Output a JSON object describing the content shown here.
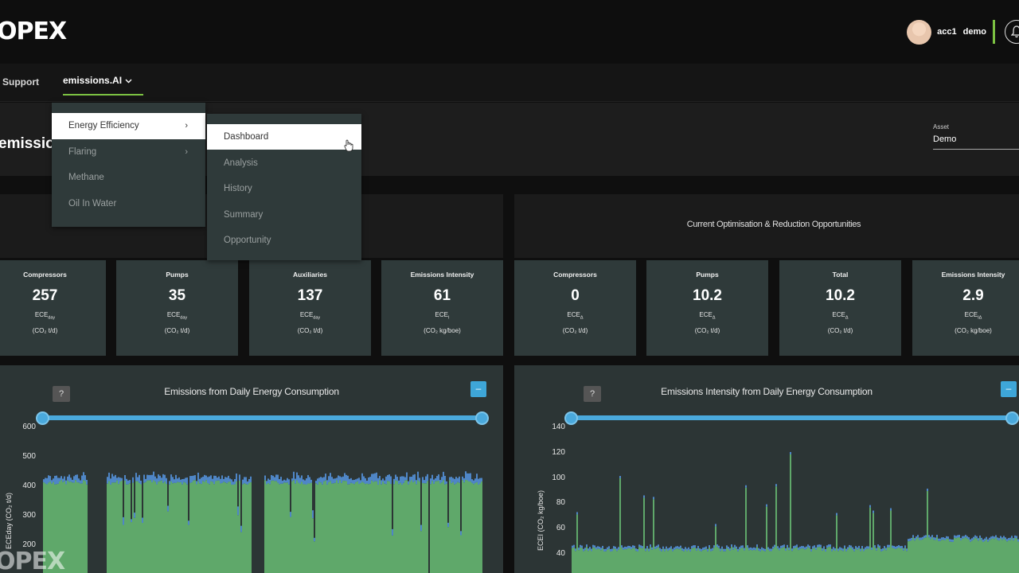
{
  "header": {
    "logo": "OPEX",
    "user": "acc1",
    "account": "demo",
    "icons": [
      "avatar",
      "bell-icon"
    ]
  },
  "nav": {
    "support": "Support",
    "emissions": "emissions.AI"
  },
  "page": {
    "title": "emissio",
    "asset_label": "Asset",
    "asset_value": "Demo"
  },
  "menu": {
    "items": [
      {
        "label": "Energy Efficiency",
        "has_sub": true,
        "active": true
      },
      {
        "label": "Flaring",
        "has_sub": true,
        "active": false
      },
      {
        "label": "Methane",
        "has_sub": false,
        "active": false
      },
      {
        "label": "Oil In Water",
        "has_sub": false,
        "active": false
      }
    ],
    "submenu": [
      {
        "label": "Dashboard",
        "active": true
      },
      {
        "label": "Analysis",
        "active": false
      },
      {
        "label": "History",
        "active": false
      },
      {
        "label": "Summary",
        "active": false
      },
      {
        "label": "Opportunity",
        "active": false
      }
    ]
  },
  "opportunities_title": "Current Optimisation & Reduction Opportunities",
  "cards": [
    {
      "label": "Compressors",
      "value": "257",
      "unit": "ECE",
      "unit_sub": "day",
      "sub": "(CO₂ t/d)"
    },
    {
      "label": "Pumps",
      "value": "35",
      "unit": "ECE",
      "unit_sub": "day",
      "sub": "(CO₂ t/d)"
    },
    {
      "label": "Auxiliaries",
      "value": "137",
      "unit": "ECE",
      "unit_sub": "day",
      "sub": "(CO₂ t/d)"
    },
    {
      "label": "Emissions Intensity",
      "value": "61",
      "unit": "ECE",
      "unit_sub": "I",
      "sub": "(CO₂ kg/boe)"
    },
    {
      "label": "Compressors",
      "value": "0",
      "unit": "ECE",
      "unit_sub": "Δ",
      "sub": "(CO₂ t/d)"
    },
    {
      "label": "Pumps",
      "value": "10.2",
      "unit": "ECE",
      "unit_sub": "Δ",
      "sub": "(CO₂ t/d)"
    },
    {
      "label": "Total",
      "value": "10.2",
      "unit": "ECE",
      "unit_sub": "Δ",
      "sub": "(CO₂ t/d)"
    },
    {
      "label": "Emissions Intensity",
      "value": "2.9",
      "unit": "ECE",
      "unit_sub": "IΔ",
      "sub": "(CO₂ kg/boe)"
    }
  ],
  "charts": {
    "left": {
      "title": "Emissions from Daily Energy Consumption",
      "ylabel": "ECEday (CO₂ t/d)",
      "yticks": [
        "600",
        "500",
        "400",
        "300",
        "200"
      ]
    },
    "right": {
      "title": "Emissions Intensity from Daily Energy Consumption",
      "ylabel": "ECEI (CO₂ kg/boe)",
      "yticks": [
        "140",
        "120",
        "100",
        "80",
        "60",
        "40"
      ]
    }
  },
  "buttons": {
    "help": "?",
    "minimize": "–"
  },
  "watermark": "OPEX",
  "colors": {
    "accent_green": "#7cc242",
    "bar_green": "#5fa86a",
    "bar_blue": "#4f86c6",
    "slider_blue": "#4aa9dc",
    "card_bg": "#2f3a3a"
  }
}
